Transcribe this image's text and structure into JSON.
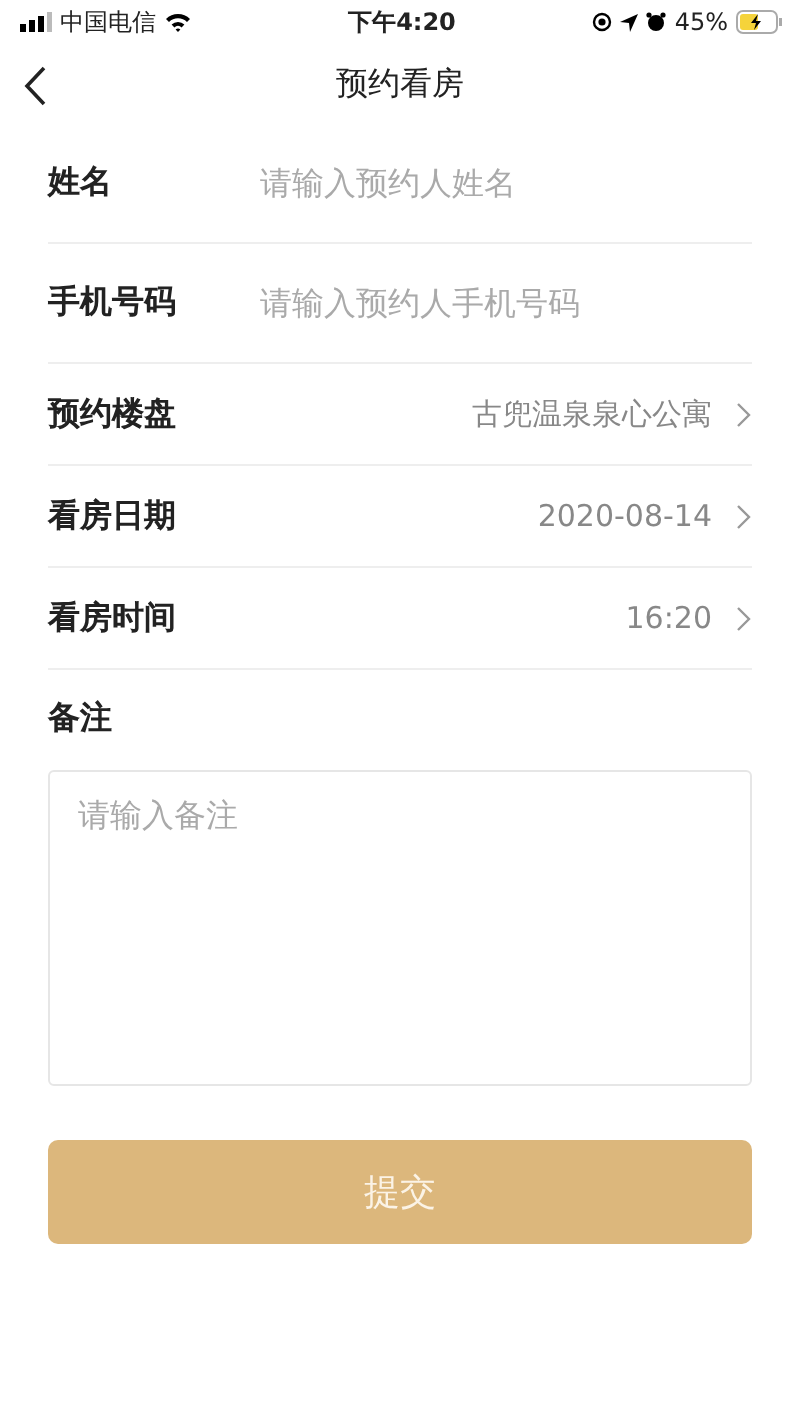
{
  "status_bar": {
    "carrier": "中国电信",
    "time": "下午4:20",
    "battery_percent": "45%",
    "charging": true
  },
  "nav": {
    "title": "预约看房"
  },
  "fields": [
    {
      "kind": "input",
      "label": "姓名",
      "placeholder": "请输入预约人姓名"
    },
    {
      "kind": "input",
      "label": "手机号码",
      "placeholder": "请输入预约人手机号码"
    },
    {
      "kind": "select",
      "label": "预约楼盘",
      "value": "古兜温泉泉心公寓"
    },
    {
      "kind": "select",
      "label": "看房日期",
      "value": "2020-08-14"
    },
    {
      "kind": "select",
      "label": "看房时间",
      "value": "16:20"
    }
  ],
  "remark": {
    "label": "备注",
    "placeholder": "请输入备注"
  },
  "submit": {
    "label": "提交",
    "disabled": true
  }
}
